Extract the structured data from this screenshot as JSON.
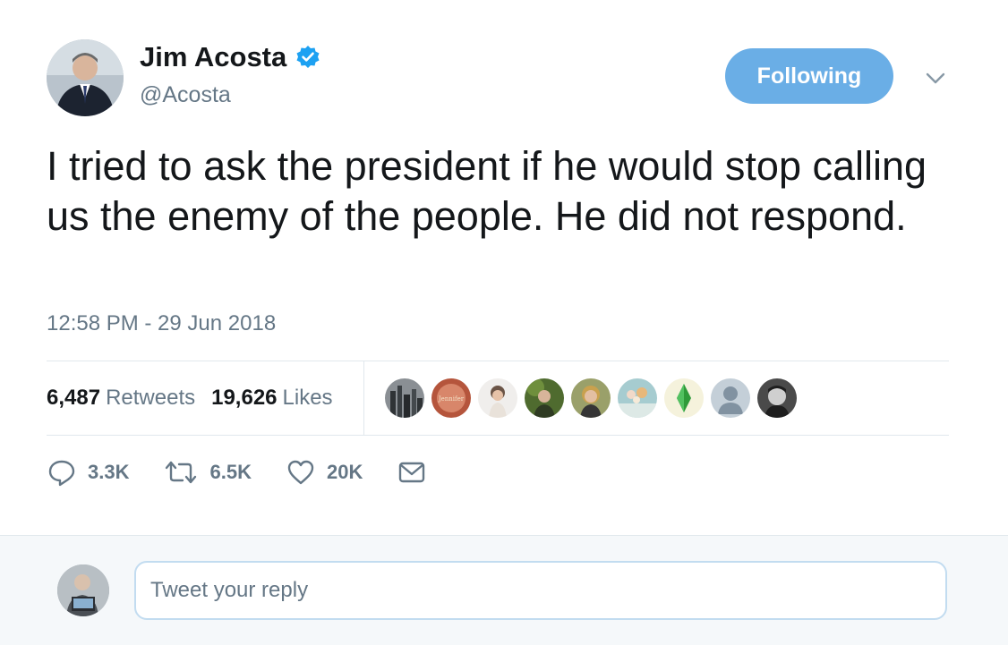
{
  "tweet": {
    "author": {
      "name": "Jim Acosta",
      "handle": "@Acosta",
      "verified": true
    },
    "follow_label": "Following",
    "text": "I tried to ask the president if he would stop calling us the enemy of the people. He did not respond.",
    "timestamp": "12:58 PM - 29 Jun 2018",
    "stats": {
      "retweets_count": "6,487",
      "retweets_label": "Retweets",
      "likes_count": "19,626",
      "likes_label": "Likes"
    },
    "liker_avatars_shown": 9,
    "liker_avatar_3_text": "Jennifer",
    "actions": {
      "reply_count": "3.3K",
      "retweet_count": "6.5K",
      "like_count": "20K"
    }
  },
  "reply_box": {
    "placeholder": "Tweet your reply",
    "value": ""
  },
  "colors": {
    "accent": "#6aaee6",
    "verified": "#1da1f2",
    "text_primary": "#14171a",
    "text_secondary": "#657786",
    "divider": "#e1e8ed",
    "reply_bg": "#f5f8fa"
  },
  "icons": {
    "verified": "verified-badge-icon",
    "caret": "chevron-down-icon",
    "reply": "reply-icon",
    "retweet": "retweet-icon",
    "like": "heart-icon",
    "dm": "envelope-icon"
  }
}
